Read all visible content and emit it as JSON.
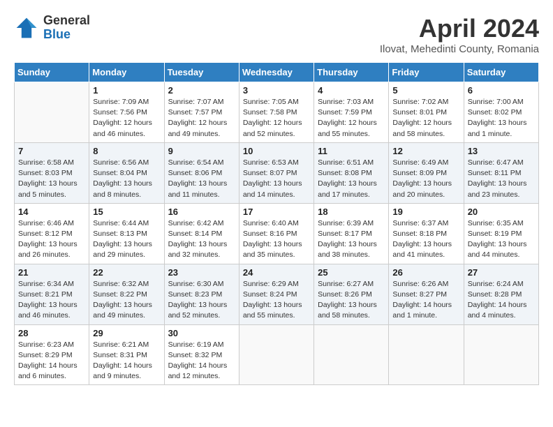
{
  "header": {
    "logo_general": "General",
    "logo_blue": "Blue",
    "month_title": "April 2024",
    "subtitle": "Ilovat, Mehedinti County, Romania"
  },
  "weekdays": [
    "Sunday",
    "Monday",
    "Tuesday",
    "Wednesday",
    "Thursday",
    "Friday",
    "Saturday"
  ],
  "weeks": [
    {
      "shade": false,
      "days": [
        {
          "num": "",
          "info": ""
        },
        {
          "num": "1",
          "info": "Sunrise: 7:09 AM\nSunset: 7:56 PM\nDaylight: 12 hours\nand 46 minutes."
        },
        {
          "num": "2",
          "info": "Sunrise: 7:07 AM\nSunset: 7:57 PM\nDaylight: 12 hours\nand 49 minutes."
        },
        {
          "num": "3",
          "info": "Sunrise: 7:05 AM\nSunset: 7:58 PM\nDaylight: 12 hours\nand 52 minutes."
        },
        {
          "num": "4",
          "info": "Sunrise: 7:03 AM\nSunset: 7:59 PM\nDaylight: 12 hours\nand 55 minutes."
        },
        {
          "num": "5",
          "info": "Sunrise: 7:02 AM\nSunset: 8:01 PM\nDaylight: 12 hours\nand 58 minutes."
        },
        {
          "num": "6",
          "info": "Sunrise: 7:00 AM\nSunset: 8:02 PM\nDaylight: 13 hours\nand 1 minute."
        }
      ]
    },
    {
      "shade": true,
      "days": [
        {
          "num": "7",
          "info": "Sunrise: 6:58 AM\nSunset: 8:03 PM\nDaylight: 13 hours\nand 5 minutes."
        },
        {
          "num": "8",
          "info": "Sunrise: 6:56 AM\nSunset: 8:04 PM\nDaylight: 13 hours\nand 8 minutes."
        },
        {
          "num": "9",
          "info": "Sunrise: 6:54 AM\nSunset: 8:06 PM\nDaylight: 13 hours\nand 11 minutes."
        },
        {
          "num": "10",
          "info": "Sunrise: 6:53 AM\nSunset: 8:07 PM\nDaylight: 13 hours\nand 14 minutes."
        },
        {
          "num": "11",
          "info": "Sunrise: 6:51 AM\nSunset: 8:08 PM\nDaylight: 13 hours\nand 17 minutes."
        },
        {
          "num": "12",
          "info": "Sunrise: 6:49 AM\nSunset: 8:09 PM\nDaylight: 13 hours\nand 20 minutes."
        },
        {
          "num": "13",
          "info": "Sunrise: 6:47 AM\nSunset: 8:11 PM\nDaylight: 13 hours\nand 23 minutes."
        }
      ]
    },
    {
      "shade": false,
      "days": [
        {
          "num": "14",
          "info": "Sunrise: 6:46 AM\nSunset: 8:12 PM\nDaylight: 13 hours\nand 26 minutes."
        },
        {
          "num": "15",
          "info": "Sunrise: 6:44 AM\nSunset: 8:13 PM\nDaylight: 13 hours\nand 29 minutes."
        },
        {
          "num": "16",
          "info": "Sunrise: 6:42 AM\nSunset: 8:14 PM\nDaylight: 13 hours\nand 32 minutes."
        },
        {
          "num": "17",
          "info": "Sunrise: 6:40 AM\nSunset: 8:16 PM\nDaylight: 13 hours\nand 35 minutes."
        },
        {
          "num": "18",
          "info": "Sunrise: 6:39 AM\nSunset: 8:17 PM\nDaylight: 13 hours\nand 38 minutes."
        },
        {
          "num": "19",
          "info": "Sunrise: 6:37 AM\nSunset: 8:18 PM\nDaylight: 13 hours\nand 41 minutes."
        },
        {
          "num": "20",
          "info": "Sunrise: 6:35 AM\nSunset: 8:19 PM\nDaylight: 13 hours\nand 44 minutes."
        }
      ]
    },
    {
      "shade": true,
      "days": [
        {
          "num": "21",
          "info": "Sunrise: 6:34 AM\nSunset: 8:21 PM\nDaylight: 13 hours\nand 46 minutes."
        },
        {
          "num": "22",
          "info": "Sunrise: 6:32 AM\nSunset: 8:22 PM\nDaylight: 13 hours\nand 49 minutes."
        },
        {
          "num": "23",
          "info": "Sunrise: 6:30 AM\nSunset: 8:23 PM\nDaylight: 13 hours\nand 52 minutes."
        },
        {
          "num": "24",
          "info": "Sunrise: 6:29 AM\nSunset: 8:24 PM\nDaylight: 13 hours\nand 55 minutes."
        },
        {
          "num": "25",
          "info": "Sunrise: 6:27 AM\nSunset: 8:26 PM\nDaylight: 13 hours\nand 58 minutes."
        },
        {
          "num": "26",
          "info": "Sunrise: 6:26 AM\nSunset: 8:27 PM\nDaylight: 14 hours\nand 1 minute."
        },
        {
          "num": "27",
          "info": "Sunrise: 6:24 AM\nSunset: 8:28 PM\nDaylight: 14 hours\nand 4 minutes."
        }
      ]
    },
    {
      "shade": false,
      "days": [
        {
          "num": "28",
          "info": "Sunrise: 6:23 AM\nSunset: 8:29 PM\nDaylight: 14 hours\nand 6 minutes."
        },
        {
          "num": "29",
          "info": "Sunrise: 6:21 AM\nSunset: 8:31 PM\nDaylight: 14 hours\nand 9 minutes."
        },
        {
          "num": "30",
          "info": "Sunrise: 6:19 AM\nSunset: 8:32 PM\nDaylight: 14 hours\nand 12 minutes."
        },
        {
          "num": "",
          "info": ""
        },
        {
          "num": "",
          "info": ""
        },
        {
          "num": "",
          "info": ""
        },
        {
          "num": "",
          "info": ""
        }
      ]
    }
  ]
}
